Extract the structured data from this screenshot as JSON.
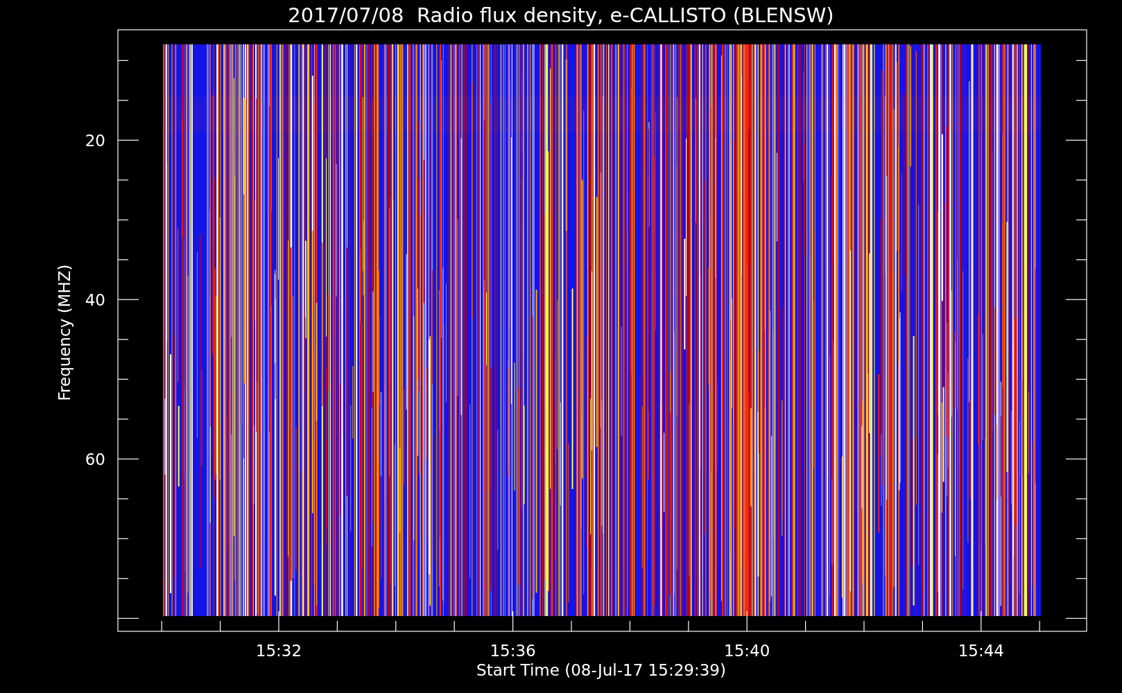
{
  "title": "2017/07/08  Radio flux density, e-CALLISTO (BLENSW)",
  "y_axis": {
    "label": "Frequency (MHZ)",
    "tick_labels": [
      "20",
      "40",
      "60"
    ]
  },
  "x_axis": {
    "label": "Start Time (08-Jul-17 15:29:39)",
    "tick_labels": [
      "15:32",
      "15:36",
      "15:40",
      "15:44"
    ]
  }
}
